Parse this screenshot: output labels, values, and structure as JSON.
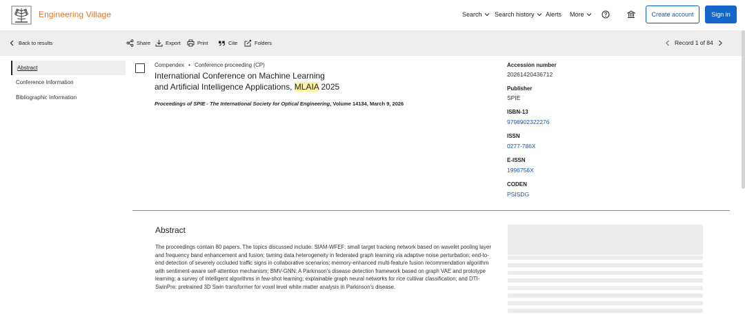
{
  "header": {
    "brand": "Engineering Village",
    "nav": [
      {
        "label": "Search"
      },
      {
        "label": "Search history"
      },
      {
        "label": "Alerts"
      },
      {
        "label": "More"
      }
    ],
    "create_account": "Create account",
    "sign_in": "Sign in",
    "icons": [
      "help-icon",
      "institution-icon"
    ]
  },
  "toolbar": {
    "back": "Back to results",
    "share": "Share",
    "export": "Export",
    "print": "Print",
    "cite": "Cite",
    "folders": "Folders",
    "record": "Record 1 of 84"
  },
  "sidebar": {
    "items": [
      {
        "label": "Abstract",
        "active": true
      },
      {
        "label": "Conference Information"
      },
      {
        "label": "Bibliographic Information"
      }
    ]
  },
  "record": {
    "database": "Compendex",
    "separator": "•",
    "doctype": "Conference proceeding (CP)",
    "title_line1": "International Conference on Machine Learning",
    "title_line2_pre": "and Artificial Intelligence Applications, ",
    "title_highlight": "MLAIA",
    "title_line2_post": " 2025",
    "source_title": "Proceedings of SPIE - The International Society for Optical Engineering",
    "source_rest": ", Volume 14134, March 9, 2026"
  },
  "details": {
    "accession_label": "Accession number",
    "accession_value": "20261420436712",
    "publisher_label": "Publisher",
    "publisher_value": "SPIE",
    "isbn_label": "ISBN-13",
    "isbn_value": "9798902322276",
    "issn_label": "ISSN",
    "issn_value": "0277-786X",
    "eissn_label": "E-ISSN",
    "eissn_value": "1996756X",
    "coden_label": "CODEN",
    "coden_value": "PSISDG"
  },
  "abstract": {
    "heading": "Abstract",
    "body": "The proceedings contain 80 papers. The topics discussed include: SIAM-WFEF: small target tracking network based on wavelet pooling layer and frequency band enhancement and fusion; taming data heterogeneity in federated graph learning via adaptive noise perturbation; end-to-end detection of severely occluded traffic signs in collaborative scenarios; memory-enhanced multi-feature fusion recommendation algorithm with sentiment-aware self-attention mechanism; BMV-GNN: A Parkinson's disease detection framework based on graph VAE and prototype learning; a survey of intelligent algorithms in few-shot learning; explainable graph neural networks for rice cultivar classification; and DTI-SwinPre: pretrained 3D Swin transformer for voxel level white matter analysis in Parkinson's disease."
  },
  "colors": {
    "brand": "#e9711c",
    "primary": "#1466c8",
    "link": "#1a5aa8",
    "highlight": "#fff3a3"
  }
}
